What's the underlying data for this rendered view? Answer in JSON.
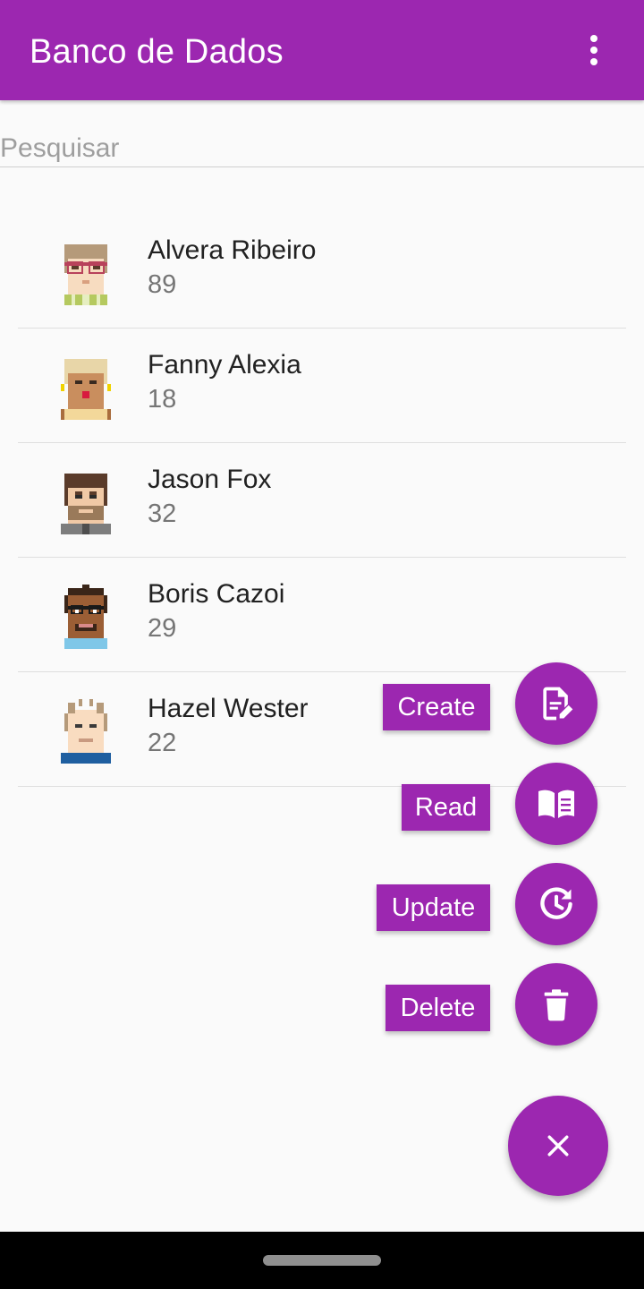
{
  "appbar": {
    "title": "Banco de Dados"
  },
  "search": {
    "placeholder": "Pesquisar",
    "value": ""
  },
  "people": [
    {
      "name": "Alvera Ribeiro",
      "age": "89"
    },
    {
      "name": "Fanny Alexia",
      "age": "18"
    },
    {
      "name": "Jason Fox",
      "age": "32"
    },
    {
      "name": "Boris Cazoi",
      "age": "29"
    },
    {
      "name": "Hazel Wester",
      "age": "22"
    }
  ],
  "actions": {
    "create": "Create",
    "read": "Read",
    "update": "Update",
    "delete": "Delete"
  },
  "colors": {
    "primary": "#9c27b0",
    "background": "#fafafa"
  }
}
